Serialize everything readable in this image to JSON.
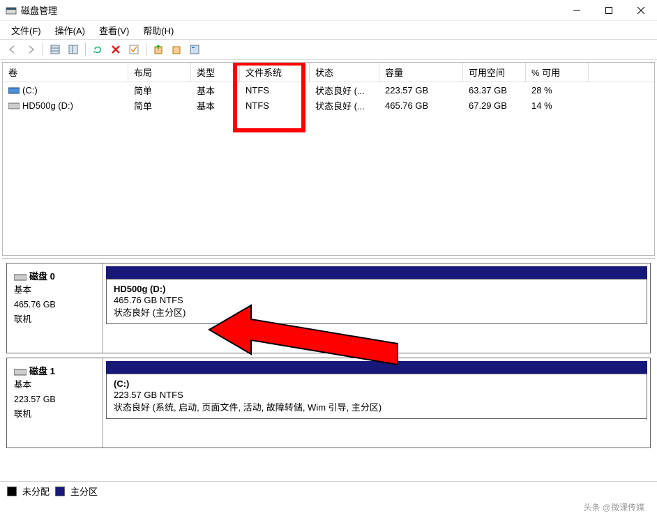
{
  "window": {
    "title": "磁盘管理"
  },
  "menu": {
    "file": "文件(F)",
    "action": "操作(A)",
    "view": "查看(V)",
    "help": "帮助(H)"
  },
  "columns": {
    "volume": "卷",
    "layout": "布局",
    "type": "类型",
    "fs": "文件系统",
    "status": "状态",
    "capacity": "容量",
    "free": "可用空间",
    "pct": "% 可用"
  },
  "volumes": [
    {
      "name": "(C:)",
      "layout": "简单",
      "type": "基本",
      "fs": "NTFS",
      "status": "状态良好 (...",
      "capacity": "223.57 GB",
      "free": "63.37 GB",
      "pct": "28 %"
    },
    {
      "name": "HD500g (D:)",
      "layout": "简单",
      "type": "基本",
      "fs": "NTFS",
      "status": "状态良好 (...",
      "capacity": "465.76 GB",
      "free": "67.29 GB",
      "pct": "14 %"
    }
  ],
  "disks": [
    {
      "label": "磁盘 0",
      "type": "基本",
      "size": "465.76 GB",
      "state": "联机",
      "part": {
        "name": "HD500g  (D:)",
        "line1": "465.76 GB NTFS",
        "line2": "状态良好 (主分区)"
      }
    },
    {
      "label": "磁盘 1",
      "type": "基本",
      "size": "223.57 GB",
      "state": "联机",
      "part": {
        "name": "(C:)",
        "line1": "223.57 GB NTFS",
        "line2": "状态良好 (系统, 启动, 页面文件, 活动, 故障转储, Wim 引导, 主分区)"
      }
    }
  ],
  "legend": {
    "unalloc": "未分配",
    "primary": "主分区"
  },
  "watermark": "头条 @微课传媒"
}
